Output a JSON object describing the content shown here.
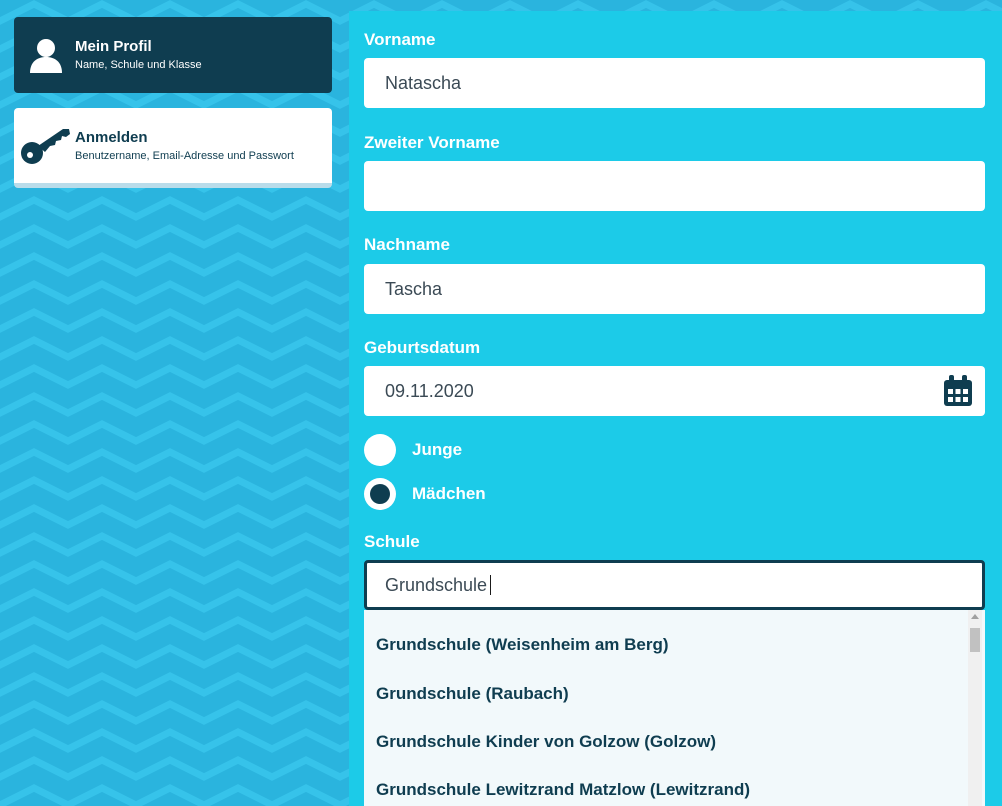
{
  "sidebar": {
    "items": [
      {
        "title": "Mein Profil",
        "subtitle": "Name, Schule und Klasse",
        "icon": "user-icon",
        "active": true
      },
      {
        "title": "Anmelden",
        "subtitle": "Benutzername, Email-Adresse und Passwort",
        "icon": "key-icon",
        "active": false
      }
    ]
  },
  "form": {
    "first_name": {
      "label": "Vorname",
      "value": "Natascha"
    },
    "middle_name": {
      "label": "Zweiter Vorname",
      "value": ""
    },
    "last_name": {
      "label": "Nachname",
      "value": "Tascha"
    },
    "birthdate": {
      "label": "Geburtsdatum",
      "value": "09.11.2020",
      "icon": "calendar-icon"
    },
    "gender": {
      "options": [
        {
          "label": "Junge",
          "selected": false
        },
        {
          "label": "Mädchen",
          "selected": true
        }
      ]
    },
    "school": {
      "label": "Schule",
      "value": "Grundschule",
      "suggestions": [
        "Grundschule (Weisenheim am Berg)",
        "Grundschule (Raubach)",
        "Grundschule Kinder von Golzow (Golzow)",
        "Grundschule Lewitzrand Matzlow (Lewitzrand)"
      ]
    }
  },
  "colors": {
    "background": "#2ab4de",
    "panel": "#1ccbe8",
    "navy": "#0f3d50",
    "white": "#ffffff",
    "dropdown": "#f2f9fb"
  }
}
